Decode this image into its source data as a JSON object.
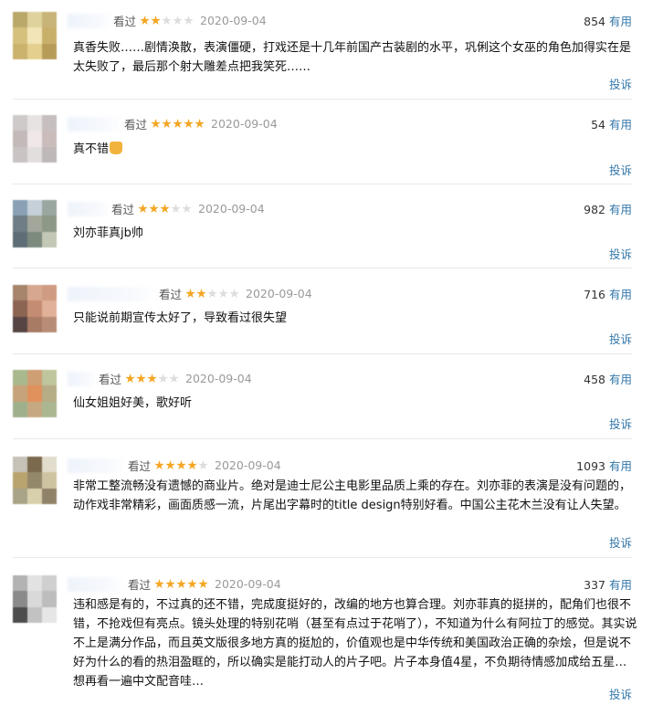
{
  "reviews": [
    {
      "watched": "看过",
      "stars": 2,
      "date": "2020-09-04",
      "votes": "854",
      "useful": "有用",
      "text": "真香失败……剧情涣散，表演僵硬，打戏还是十几年前国产古装剧的水平，巩俐这个女巫的角色加得实在是太失败了，最后那个射大雕差点把我笑死……",
      "report": "投诉",
      "colors": [
        "#b9a86a",
        "#e0d29c",
        "#c8b478",
        "#d6c07e",
        "#f2e6b8",
        "#c9b06a",
        "#cbb26d",
        "#e4cf8e",
        "#b79c58"
      ]
    },
    {
      "watched": "看过",
      "stars": 5,
      "date": "2020-09-04",
      "votes": "54",
      "useful": "有用",
      "text": "真不错",
      "report": "投诉",
      "colors": [
        "#cfcaca",
        "#e7e3e3",
        "#c7bfbf",
        "#c4b9b9",
        "#f0e7e8",
        "#cbbcbc",
        "#c9c3c3",
        "#e2dede",
        "#bfb8b8"
      ]
    },
    {
      "watched": "看过",
      "stars": 3,
      "date": "2020-09-04",
      "votes": "982",
      "useful": "有用",
      "text": "刘亦菲真jb帅",
      "report": "投诉",
      "colors": [
        "#8aa1b5",
        "#c5d0d9",
        "#9aa6a0",
        "#6f7e86",
        "#a3a69a",
        "#8d9886",
        "#5f6e76",
        "#7b8a7d",
        "#c2c8b5"
      ]
    },
    {
      "watched": "看过",
      "stars": 2,
      "date": "2020-09-04",
      "votes": "716",
      "useful": "有用",
      "text": "只能说前期宣传太好了，导致看过很失望",
      "report": "投诉",
      "colors": [
        "#a7846c",
        "#d7a88f",
        "#cf9c82",
        "#8c6452",
        "#c48c73",
        "#e2b199",
        "#574544",
        "#a87b65",
        "#b88d77"
      ]
    },
    {
      "watched": "看过",
      "stars": 3,
      "date": "2020-09-04",
      "votes": "458",
      "useful": "有用",
      "text": "仙女姐姐好美，歌好听",
      "report": "投诉",
      "colors": [
        "#a9b98d",
        "#cf9f74",
        "#bfc59c",
        "#c6a37b",
        "#e0915c",
        "#b6ac85",
        "#9fb18c",
        "#c6a982",
        "#aab791"
      ]
    },
    {
      "watched": "看过",
      "stars": 4,
      "date": "2020-09-04",
      "votes": "1093",
      "useful": "有用",
      "text": "非常工整流畅没有遗憾的商业片。绝对是迪士尼公主电影里品质上乘的存在。刘亦菲的表演是没有问题的，动作戏非常精彩，画面质感一流，片尾出字幕时的title design特别好看。中国公主花木兰没有让人失望。",
      "report": "投诉",
      "colors": [
        "#c6c2b8",
        "#7b6a4e",
        "#e2dccd",
        "#b9a46f",
        "#94886a",
        "#cfc4a2",
        "#a9a387",
        "#d8cfad",
        "#8f8268"
      ]
    },
    {
      "watched": "看过",
      "stars": 5,
      "date": "2020-09-04",
      "votes": "337",
      "useful": "有用",
      "text": "违和感是有的，不过真的还不错，完成度挺好的，改编的地方也算合理。刘亦菲真的挺拼的，配角们也很不错，不抢戏但有亮点。镜头处理的特别花哨（甚至有点过于花哨了），不知道为什么有阿拉丁的感觉。其实说不上是满分作品，而且英文版很多地方真的挺尬的，价值观也是中华传统和美国政治正确的杂烩，但是说不好为什么的看的热泪盈眶的，所以确实是能打动人的片子吧。片子本身值4星，不负期待情感加成给五星…想再看一遍中文配音哇…",
      "report": "投诉",
      "colors": [
        "#b3b3b3",
        "#e2e2e2",
        "#cfcfcf",
        "#8a8a8a",
        "#d9d9d9",
        "#bdbdbd",
        "#4d4d4d",
        "#c2c2c2",
        "#e6e6e6"
      ]
    }
  ]
}
